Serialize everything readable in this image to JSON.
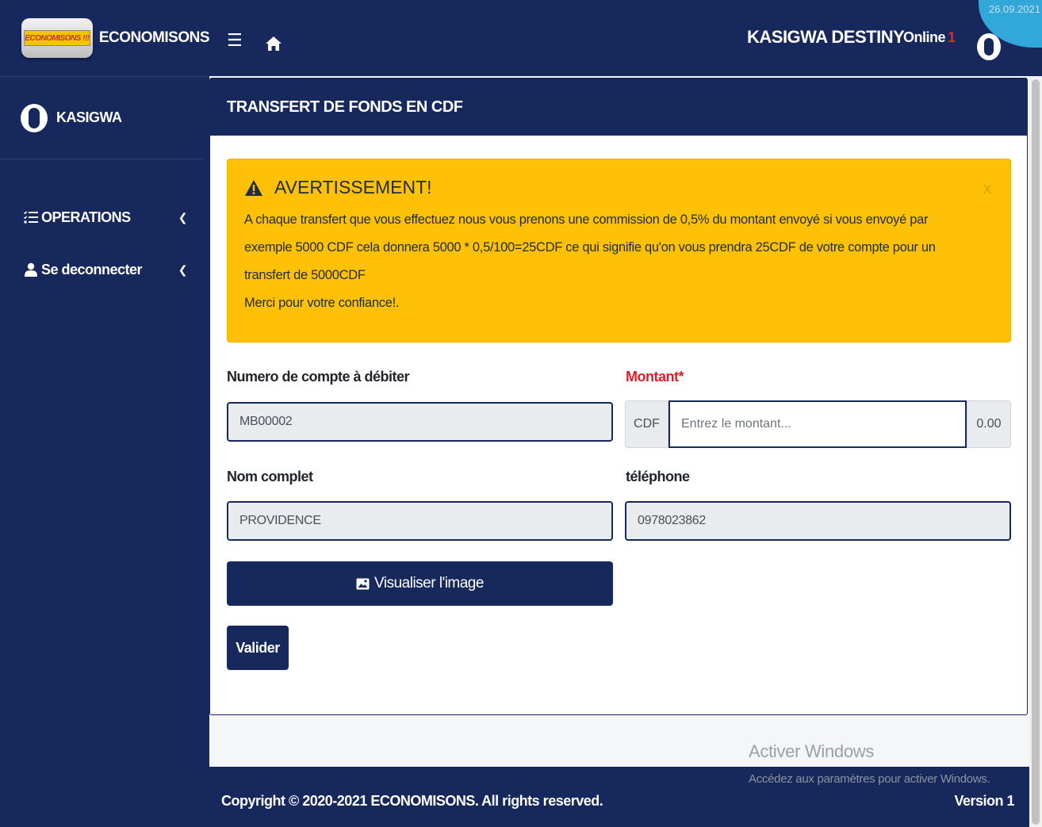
{
  "brand": {
    "logo_text": "ECONOMISONS !!!",
    "name": "ECONOMISONS"
  },
  "sidebar": {
    "user_name": "KASIGWA",
    "items": [
      {
        "label": "OPERATIONS",
        "icon": "list-icon"
      },
      {
        "label": "Se deconnecter",
        "icon": "user-icon"
      }
    ]
  },
  "header": {
    "user_name": "KASIGWA DESTINY",
    "online_label": "Online",
    "online_count": "1",
    "date": "26.09.2021"
  },
  "card": {
    "title": "TRANSFERT DE FONDS EN CDF",
    "alert": {
      "title": "AVERTISSEMENT!",
      "close": "x",
      "line1": "A chaque transfert que vous effectuez nous vous prenons une commission de 0,5% du montant envoyé si vous envoyé par",
      "line2": "exemple 5000 CDF cela donnera 5000 * 0,5/100=25CDF ce qui signifie qu'on vous prendra 25CDF de votre compte pour un",
      "line3": "transfert de 5000CDF",
      "line4": "Merci pour votre confiance!."
    },
    "fields": {
      "account_label": "Numero de compte à débiter",
      "account_value": "MB00002",
      "amount_label": "Montant*",
      "amount_prefix": "CDF",
      "amount_placeholder": "Entrez le montant...",
      "amount_suffix": "0.00",
      "name_label": "Nom complet",
      "name_value": "PROVIDENCE",
      "phone_label": "téléphone",
      "phone_value": "0978023862"
    },
    "buttons": {
      "view_image": "Visualiser l'image",
      "validate": "Valider"
    }
  },
  "watermark": {
    "title": "Activer Windows",
    "subtitle": "Accédez aux paramètres pour activer Windows."
  },
  "footer": {
    "copyright": "Copyright © 2020-2021 ECONOMISONS. All rights reserved.",
    "version": "Version 1"
  },
  "colors": {
    "navy": "#17285d",
    "warning": "#ffc107",
    "required": "#dc1f26",
    "accent": "#34b5e8"
  }
}
